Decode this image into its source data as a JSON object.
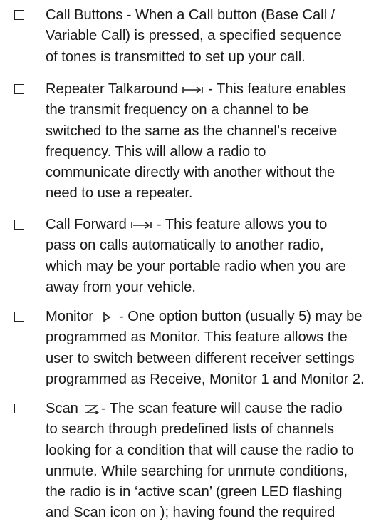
{
  "items": [
    {
      "lines": [
        "Call Buttons - When a Call button (Base Call /",
        "Variable Call) is pressed, a specified sequence",
        "of tones is transmitted to set up your call."
      ]
    },
    {
      "icon": "talkaround-arrow-icon",
      "head": "Repeater Talkaround",
      "head_rest": "- This feature enables",
      "lines": [
        "the transmit frequency on a channel to be",
        "switched to the same as the channel’s receive",
        "frequency. This will allow a radio to",
        "communicate directly with another without the",
        "need to use a repeater."
      ]
    },
    {
      "icon": "call-forward-arrow-icon",
      "head": "Call Forward",
      "head_rest": "- This feature allows you to",
      "lines": [
        "pass on calls automatically to another radio,",
        "which may be your portable radio when you are",
        "away from your vehicle."
      ]
    },
    {
      "icon": "monitor-icon",
      "head": "Monitor",
      "head_rest": "- One option button (usually 5) may be",
      "lines": [
        "programmed as Monitor. This feature allows the",
        "user to switch between different receiver settings",
        "programmed as Receive, Monitor 1 and Monitor 2."
      ]
    },
    {
      "icon": "scan-icon",
      "head": "Scan",
      "head_rest": "- The scan feature will cause the radio",
      "lines": [
        "to search through predefined lists of channels",
        "looking for a condition that will cause the radio to",
        "unmute. While searching for unmute conditions,",
        "the radio is in ‘active scan’ (green LED flashing",
        "and Scan icon on ); having found the required"
      ]
    }
  ]
}
